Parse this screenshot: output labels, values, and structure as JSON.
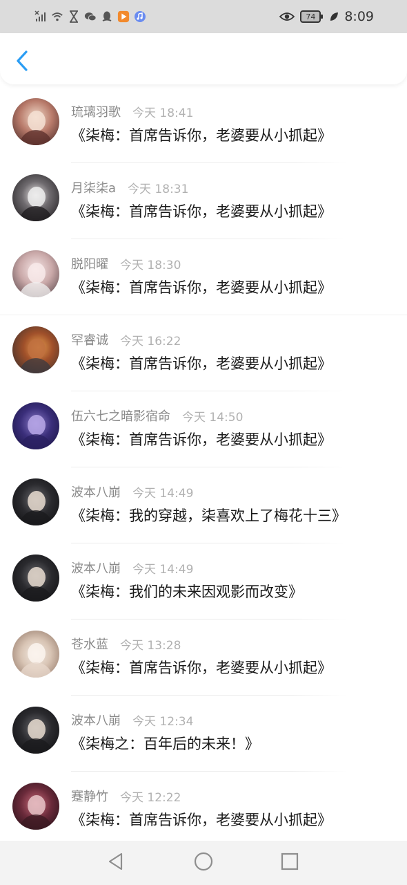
{
  "status_bar": {
    "left_icons": [
      "signal-off-icon",
      "wifi-icon",
      "hourglass-icon",
      "wechat-icon",
      "qq-icon",
      "video-app-icon",
      "music-app-icon"
    ],
    "battery_level": "74",
    "time": "8:09",
    "right_icons": [
      "eye-icon",
      "battery-icon",
      "leaf-icon"
    ]
  },
  "header": {
    "back_icon": "chevron-left-icon",
    "accent_color": "#2a9df4"
  },
  "messages": [
    {
      "name": "琉璃羽歌",
      "time": "今天 18:41",
      "text": "《柒梅：首席告诉你，老婆要从小抓起》"
    },
    {
      "name": "月柒柒a",
      "time": "今天 18:31",
      "text": "《柒梅：首席告诉你，老婆要从小抓起》"
    },
    {
      "name": "脱阳曜",
      "time": "今天 18:30",
      "text": "《柒梅：首席告诉你，老婆要从小抓起》"
    },
    {
      "name": "罕睿诚",
      "time": "今天 16:22",
      "text": "《柒梅：首席告诉你，老婆要从小抓起》"
    },
    {
      "name": "伍六七之暗影宿命",
      "time": "今天 14:50",
      "text": "《柒梅：首席告诉你，老婆要从小抓起》"
    },
    {
      "name": "波本八崩",
      "time": "今天 14:49",
      "text": "《柒梅：我的穿越，柒喜欢上了梅花十三》"
    },
    {
      "name": "波本八崩",
      "time": "今天 14:49",
      "text": "《柒梅：我们的未来因观影而改变》"
    },
    {
      "name": "苍水蓝",
      "time": "今天 13:28",
      "text": "《柒梅：首席告诉你，老婆要从小抓起》"
    },
    {
      "name": "波本八崩",
      "time": "今天 12:34",
      "text": "《柒梅之：百年后的未来！》"
    },
    {
      "name": "蹇静竹",
      "time": "今天 12:22",
      "text": "《柒梅：首席告诉你，老婆要从小抓起》"
    }
  ],
  "nav_bar": {
    "icons": [
      "back-triangle-icon",
      "home-circle-icon",
      "recents-square-icon"
    ]
  }
}
